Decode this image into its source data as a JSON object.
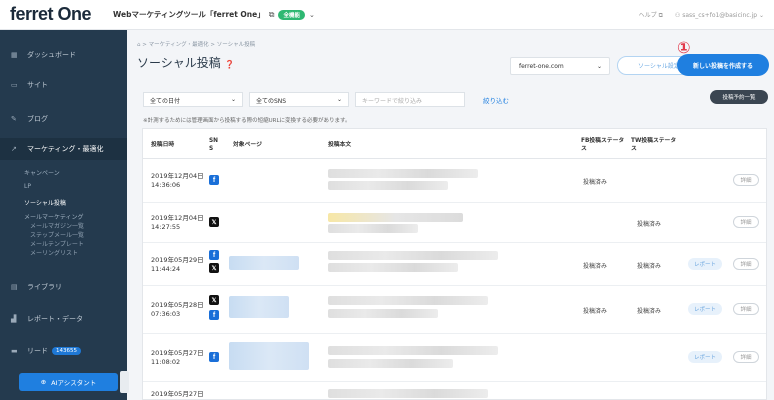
{
  "header": {
    "logo": "ferret One",
    "tool_name": "Webマーケティングツール「ferret One」",
    "plan_badge": "全機能",
    "help": "ヘルプ",
    "user": "sass_cs+fo1@basicinc.jp"
  },
  "sidebar": {
    "items": [
      {
        "label": "ダッシュボード"
      },
      {
        "label": "サイト"
      },
      {
        "label": "ブログ"
      },
      {
        "label": "マーケティング・最適化"
      },
      {
        "label": "ライブラリ"
      },
      {
        "label": "レポート・データ"
      },
      {
        "label": "リード"
      }
    ],
    "lead_count": "143655",
    "subitems": [
      "キャンペーン",
      "LP",
      "ソーシャル投稿",
      "メールマーケティング"
    ],
    "subsubitems": [
      "メールマガジン一覧",
      "ステップメール一覧",
      "メールテンプレート",
      "メーリングリスト"
    ],
    "ai_button": "AIアシスタント"
  },
  "main": {
    "breadcrumb": "マーケティング・最適化 > ソーシャル投稿",
    "title": "ソーシャル投稿",
    "site_select": "ferret-one.com",
    "social_settings_button": "ソーシャル設定",
    "new_post_button": "新しい投稿を作成する",
    "annotation": "①",
    "filters": {
      "date": "全ての日付",
      "sns": "全てのSNS",
      "keyword_placeholder": "キーワードで絞り込み",
      "apply": "絞り込む"
    },
    "schedule_button": "投稿予約一覧",
    "notice": "※計測するためには管理画面から投稿する際の短縮URLに変換する必要があります。"
  },
  "table": {
    "headers": {
      "date": "投稿日時",
      "sns": "SNS",
      "target": "対象ページ",
      "body": "投稿本文",
      "fb_status": "FB投稿ステータス",
      "tw_status": "TW投稿ステータス"
    },
    "rows": [
      {
        "date": "2019年12月04日",
        "time": "14:36:06",
        "fb": "投稿済み",
        "tw": "",
        "report": "",
        "detail": "詳細"
      },
      {
        "date": "2019年12月04日",
        "time": "14:27:55",
        "fb": "",
        "tw": "投稿済み",
        "report": "",
        "detail": "詳細"
      },
      {
        "date": "2019年05月29日",
        "time": "11:44:24",
        "fb": "投稿済み",
        "tw": "投稿済み",
        "report": "レポート",
        "detail": "詳細"
      },
      {
        "date": "2019年05月28日",
        "time": "07:36:03",
        "fb": "投稿済み",
        "tw": "投稿済み",
        "report": "レポート",
        "detail": "詳細"
      },
      {
        "date": "2019年05月27日",
        "time": "11:08:02",
        "fb": "",
        "tw": "",
        "report": "レポート",
        "detail": "詳細"
      },
      {
        "date": "2019年05月27日",
        "time": "",
        "fb": "",
        "tw": "",
        "report": "",
        "detail": ""
      }
    ]
  },
  "colors": {
    "sidebar": "#243a4e",
    "accent": "#1f7fe0",
    "annotation": "#e2384a",
    "facebook": "#1a6fd8",
    "x": "#111111"
  }
}
